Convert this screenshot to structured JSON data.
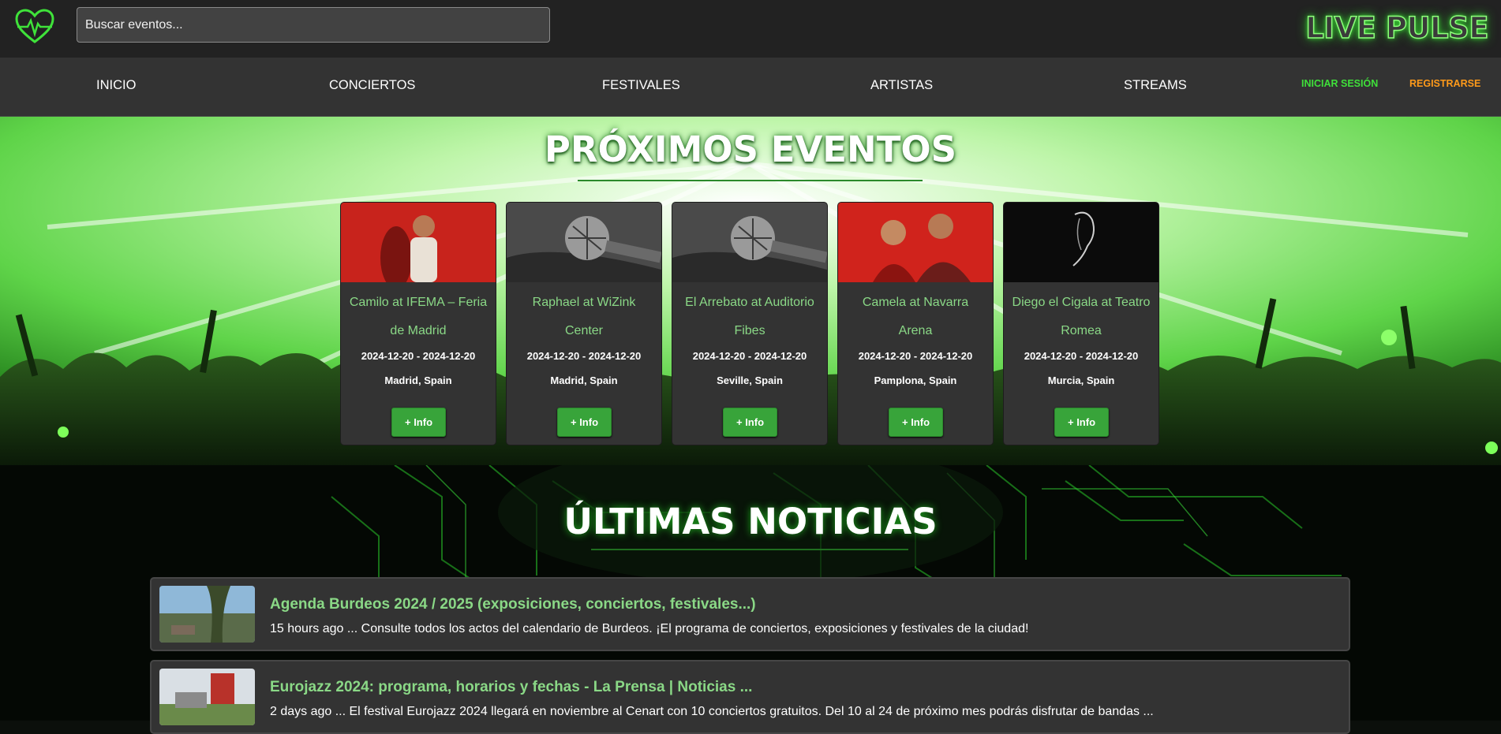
{
  "header": {
    "brand": "LIVE PULSE",
    "search_placeholder": "Buscar eventos...",
    "logo_icon": "heart-pulse-icon",
    "accent": "#3fe23a"
  },
  "nav": {
    "items": [
      "INICIO",
      "CONCIERTOS",
      "FESTIVALES",
      "ARTISTAS",
      "STREAMS"
    ],
    "login": "INICIAR SESIÓN",
    "register": "REGISTRARSE",
    "login_color": "#3fe03a",
    "register_color": "#ff9a1a"
  },
  "events": {
    "title": "PRÓXIMOS EVENTOS",
    "items": [
      {
        "title": "Camilo at IFEMA – Feria de Madrid",
        "dates": "2024-12-20 - 2024-12-20",
        "location": "Madrid, Spain",
        "button": "+ Info"
      },
      {
        "title": "Raphael at WiZink Center",
        "dates": "2024-12-20 - 2024-12-20",
        "location": "Madrid, Spain",
        "button": "+ Info"
      },
      {
        "title": "El Arrebato at Auditorio Fibes",
        "dates": "2024-12-20 - 2024-12-20",
        "location": "Seville, Spain",
        "button": "+ Info"
      },
      {
        "title": "Camela at Navarra Arena",
        "dates": "2024-12-20 - 2024-12-20",
        "location": "Pamplona, Spain",
        "button": "+ Info"
      },
      {
        "title": "Diego el Cigala at Teatro Romea",
        "dates": "2024-12-20 - 2024-12-20",
        "location": "Murcia, Spain",
        "button": "+ Info"
      }
    ]
  },
  "news": {
    "title": "ÚLTIMAS NOTICIAS",
    "items": [
      {
        "title": "Agenda Burdeos 2024 / 2025 (exposiciones, conciertos, festivales...)",
        "snippet": "15 hours ago ... Consulte todos los actos del calendario de Burdeos. ¡El programa de conciertos, exposiciones y festivales de la ciudad!"
      },
      {
        "title": "Eurojazz 2024: programa, horarios y fechas - La Prensa | Noticias ...",
        "snippet": "2 days ago ... El festival Eurojazz 2024 llegará en noviembre al Cenart con 10 conciertos gratuitos. Del 10 al 24 de próximo mes podrás disfrutar de bandas ..."
      }
    ]
  }
}
